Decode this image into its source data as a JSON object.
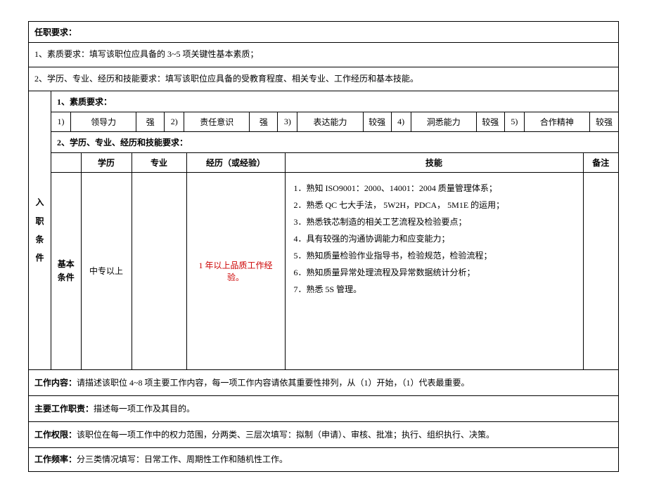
{
  "topSection": {
    "heading": "任职要求：",
    "line1": "1、素质要求：填写该职位应具备的 3~5 项关键性基本素质；",
    "line2": "2、学历、专业、经历和技能要求：填写该职位应具备的受教育程度、相关专业、工作经历和基本技能。"
  },
  "sideLabel": {
    "c1": "入",
    "c2": "职",
    "c3": "条",
    "c4": "件"
  },
  "qualityHeader": "1、素质要求：",
  "quality": [
    {
      "num": "1)",
      "label": "领导力",
      "rating": "强"
    },
    {
      "num": "2)",
      "label": "责任意识",
      "rating": "强"
    },
    {
      "num": "3)",
      "label": "表达能力",
      "rating": "较强"
    },
    {
      "num": "4)",
      "label": "洞悉能力",
      "rating": "较强"
    },
    {
      "num": "5)",
      "label": "合作精神",
      "rating": "较强"
    }
  ],
  "eduHeader": "2、学历、专业、经历和技能要求：",
  "eduTable": {
    "headers": {
      "blank": "",
      "edu": "学历",
      "major": "专业",
      "exp": "经历（或经验）",
      "skill": "技能",
      "note": "备注"
    },
    "row": {
      "cond": "基本\n条件",
      "edu": "中专以上",
      "major": "",
      "exp": "1 年以上品质工作经验。",
      "skills": [
        "1．熟知 ISO9001：2000、14001：2004 质量管理体系；",
        "2．熟悉 QC 七大手法， 5W2H，PDCA， 5M1E 的运用；",
        "3．熟悉铁芯制造的相关工艺流程及检验要点；",
        "4．具有较强的沟通协调能力和应变能力；",
        "5．熟知质量检验作业指导书，检验规范，检验流程；",
        "6．熟知质量异常处理流程及异常数据统计分析；",
        "7．熟悉 5S 管理。"
      ],
      "note": ""
    }
  },
  "bottom": {
    "line1_label": "工作内容：",
    "line1_text": "请描述该职位 4~8 项主要工作内容，每一项工作内容请依其重要性排列，从（1）开始，（1）代表最重要。",
    "line2_label": "主要工作职责：",
    "line2_text": "描述每一项工作及其目的。",
    "line3_label": "工作权限：",
    "line3_text": "该职位在每一项工作中的权力范围，分两类、三层次填写：拟制（申请）、审核、批准；执行、组织执行、决策。",
    "line4_label": "工作频率：",
    "line4_text": "分三类情况填写：日常工作、周期性工作和随机性工作。"
  }
}
